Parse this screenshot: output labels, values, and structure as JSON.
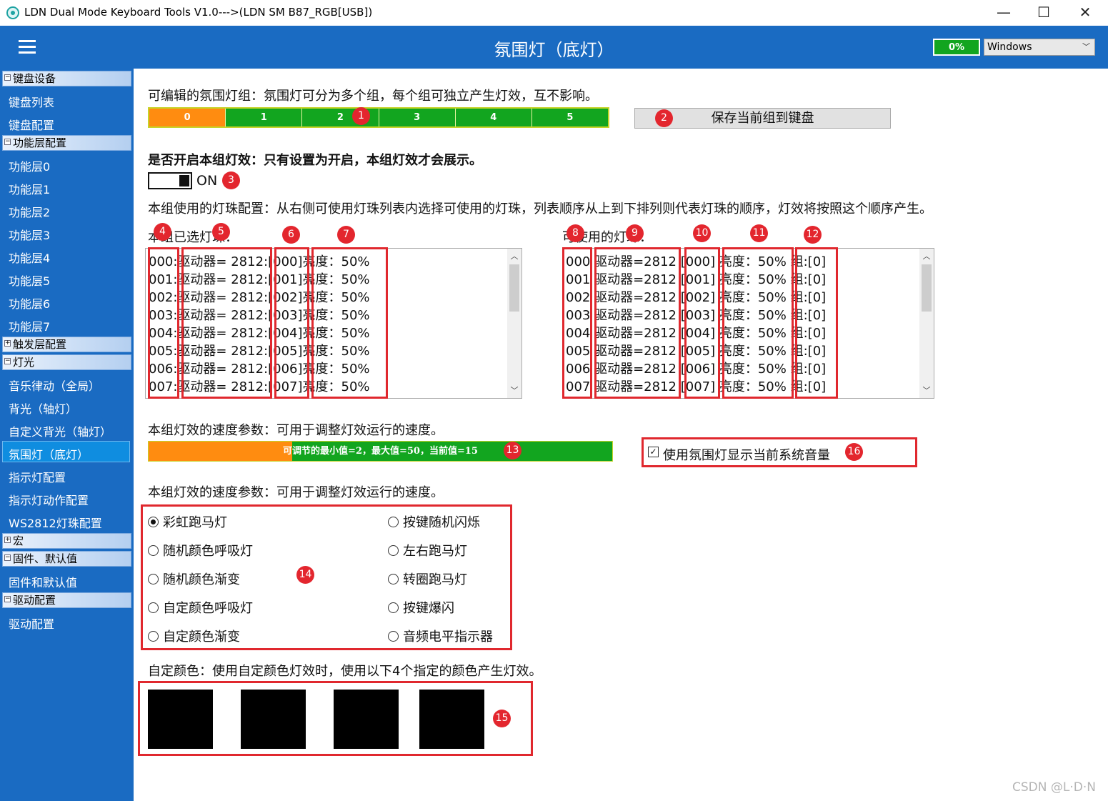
{
  "window": {
    "title": "LDN Dual Mode Keyboard Tools V1.0--->(LDN SM B87_RGB[USB])",
    "minimize": "—",
    "maximize": "☐",
    "close": "✕"
  },
  "header": {
    "title": "氛围灯（底灯）",
    "progress": "0%",
    "os_select": "Windows"
  },
  "sidebar": {
    "groups": [
      {
        "label": "键盘设备",
        "expanded": true,
        "items": [
          "键盘列表",
          "键盘配置"
        ]
      },
      {
        "label": "功能层配置",
        "expanded": true,
        "items": [
          "功能层0",
          "功能层1",
          "功能层2",
          "功能层3",
          "功能层4",
          "功能层5",
          "功能层6",
          "功能层7"
        ]
      },
      {
        "label": "触发层配置",
        "expanded": false,
        "items": []
      },
      {
        "label": "灯光",
        "expanded": true,
        "items": [
          "音乐律动（全局）",
          "背光（轴灯）",
          "自定义背光（轴灯）",
          "氛围灯（底灯）",
          "指示灯配置",
          "指示灯动作配置",
          "WS2812灯珠配置"
        ]
      },
      {
        "label": "宏",
        "expanded": false,
        "items": []
      },
      {
        "label": "固件、默认值",
        "expanded": true,
        "items": [
          "固件和默认值"
        ]
      },
      {
        "label": "驱动配置",
        "expanded": true,
        "items": [
          "驱动配置"
        ]
      }
    ],
    "active_item": "氛围灯（底灯）"
  },
  "main": {
    "group_intro": "可编辑的氛围灯组：氛围灯可分为多个组，每个组可独立产生灯效，互不影响。",
    "groups": [
      "0",
      "1",
      "2",
      "3",
      "4",
      "5"
    ],
    "selected_group": "0",
    "save_button": "保存当前组到键盘",
    "enable_prompt": "是否开启本组灯效：只有设置为开启，本组灯效才会展示。",
    "toggle_label": "ON",
    "toggle_on": true,
    "led_config_desc": "本组使用的灯珠配置：从右侧可使用灯珠列表内选择可使用的灯珠，列表顺序从上到下排列则代表灯珠的顺序，灯效将按照这个顺序产生。",
    "selected_list_label": "本组已选灯珠：",
    "available_list_label": "可使用的灯珠：",
    "selected_leds": [
      {
        "idx": "000:",
        "driver": "驱动器= 2812:",
        "id": "[000]",
        "brightness": "亮度：50%"
      },
      {
        "idx": "001:",
        "driver": "驱动器= 2812:",
        "id": "[001]",
        "brightness": "亮度：50%"
      },
      {
        "idx": "002:",
        "driver": "驱动器= 2812:",
        "id": "[002]",
        "brightness": "亮度：50%"
      },
      {
        "idx": "003:",
        "driver": "驱动器= 2812:",
        "id": "[003]",
        "brightness": "亮度：50%"
      },
      {
        "idx": "004:",
        "driver": "驱动器= 2812:",
        "id": "[004]",
        "brightness": "亮度：50%"
      },
      {
        "idx": "005:",
        "driver": "驱动器= 2812:",
        "id": "[005]",
        "brightness": "亮度：50%"
      },
      {
        "idx": "006:",
        "driver": "驱动器= 2812:",
        "id": "[006]",
        "brightness": "亮度：50%"
      },
      {
        "idx": "007:",
        "driver": "驱动器= 2812:",
        "id": "[007]",
        "brightness": "亮度：50%"
      }
    ],
    "available_leds": [
      {
        "idx": "000",
        "driver": "驱动器=2812",
        "id": "[000]",
        "brightness": "亮度：50%",
        "group": "组:[0]"
      },
      {
        "idx": "001",
        "driver": "驱动器=2812",
        "id": "[001]",
        "brightness": "亮度：50%",
        "group": "组:[0]"
      },
      {
        "idx": "002",
        "driver": "驱动器=2812",
        "id": "[002]",
        "brightness": "亮度：50%",
        "group": "组:[0]"
      },
      {
        "idx": "003",
        "driver": "驱动器=2812",
        "id": "[003]",
        "brightness": "亮度：50%",
        "group": "组:[0]"
      },
      {
        "idx": "004",
        "driver": "驱动器=2812",
        "id": "[004]",
        "brightness": "亮度：50%",
        "group": "组:[0]"
      },
      {
        "idx": "005",
        "driver": "驱动器=2812",
        "id": "[005]",
        "brightness": "亮度：50%",
        "group": "组:[0]"
      },
      {
        "idx": "006",
        "driver": "驱动器=2812",
        "id": "[006]",
        "brightness": "亮度：50%",
        "group": "组:[0]"
      },
      {
        "idx": "007",
        "driver": "驱动器=2812",
        "id": "[007]",
        "brightness": "亮度：50%",
        "group": "组:[0]"
      }
    ],
    "speed_label": "本组灯效的速度参数：可用于调整灯效运行的速度。",
    "speed_text": "可调节的最小值=2，最大值=50，当前值=15",
    "speed_min": 2,
    "speed_max": 50,
    "speed_value": 15,
    "volume_checkbox": "使用氛围灯显示当前系统音量",
    "volume_checked": true,
    "effect_label": "本组灯效的速度参数：可用于调整灯效运行的速度。",
    "effects_left": [
      "彩虹跑马灯",
      "随机颜色呼吸灯",
      "随机颜色渐变",
      "自定颜色呼吸灯",
      "自定颜色渐变"
    ],
    "effects_right": [
      "按键随机闪烁",
      "左右跑马灯",
      "转圈跑马灯",
      "按键爆闪",
      "音频电平指示器"
    ],
    "selected_effect": "彩虹跑马灯",
    "custom_color_label": "自定颜色：使用自定颜色灯效时，使用以下4个指定的颜色产生灯效。",
    "custom_colors": [
      "#000000",
      "#000000",
      "#000000",
      "#000000"
    ]
  },
  "annotations": [
    "1",
    "2",
    "3",
    "4",
    "5",
    "6",
    "7",
    "8",
    "9",
    "10",
    "11",
    "12",
    "13",
    "14",
    "15",
    "16"
  ],
  "watermark": "CSDN @L·D·N",
  "colors": {
    "accent": "#1a6bc2",
    "selected_orange": "#ff8c10",
    "green": "#12a51f",
    "annotation_red": "#e0282e"
  }
}
